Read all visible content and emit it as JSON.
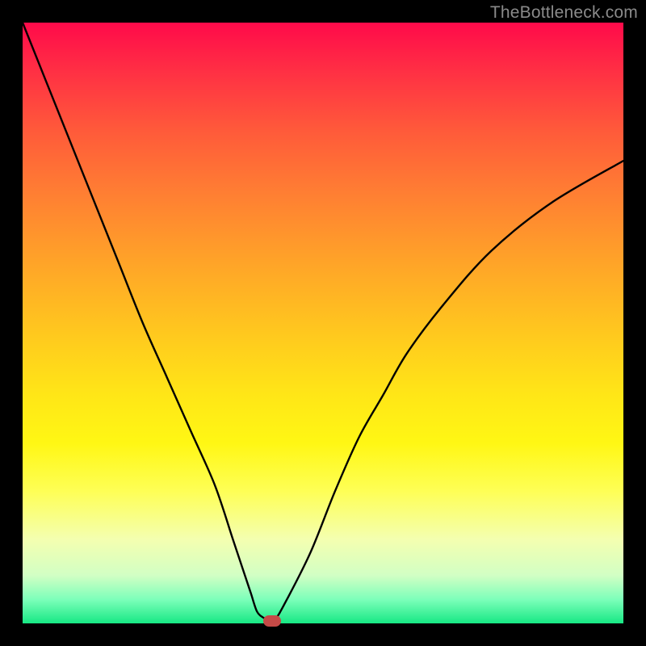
{
  "watermark": "TheBottleneck.com",
  "colors": {
    "frame": "#000000",
    "gradient_top": "#ff0a4a",
    "gradient_bottom": "#17e884",
    "curve": "#000000",
    "marker": "#c54a47",
    "watermark_text": "#8a8a8a"
  },
  "chart_data": {
    "type": "line",
    "title": "",
    "xlabel": "",
    "ylabel": "",
    "xlim": [
      0,
      100
    ],
    "ylim": [
      0,
      100
    ],
    "grid": false,
    "legend": false,
    "series": [
      {
        "name": "bottleneck-curve",
        "x": [
          0,
          4,
          8,
          12,
          16,
          20,
          24,
          28,
          32,
          35,
          37,
          38,
          39,
          40,
          41,
          42,
          44,
          48,
          52,
          56,
          60,
          64,
          70,
          78,
          88,
          100
        ],
        "y": [
          100,
          90,
          80,
          70,
          60,
          50,
          41,
          32,
          23,
          14,
          8,
          5,
          2,
          1,
          0.6,
          0.6,
          4,
          12,
          22,
          31,
          38,
          45,
          53,
          62,
          70,
          77
        ]
      }
    ],
    "annotations": [
      {
        "name": "optimal-marker",
        "x": 41.5,
        "y": 0,
        "shape": "rounded-rect",
        "color": "#c54a47"
      }
    ],
    "background": {
      "type": "vertical-gradient",
      "description": "red at top through orange, yellow, pale yellow to green at bottom",
      "stops": [
        {
          "pos": 0.0,
          "color": "#ff0a4a"
        },
        {
          "pos": 0.5,
          "color": "#ffc91e"
        },
        {
          "pos": 0.8,
          "color": "#feff56"
        },
        {
          "pos": 1.0,
          "color": "#17e884"
        }
      ]
    }
  }
}
